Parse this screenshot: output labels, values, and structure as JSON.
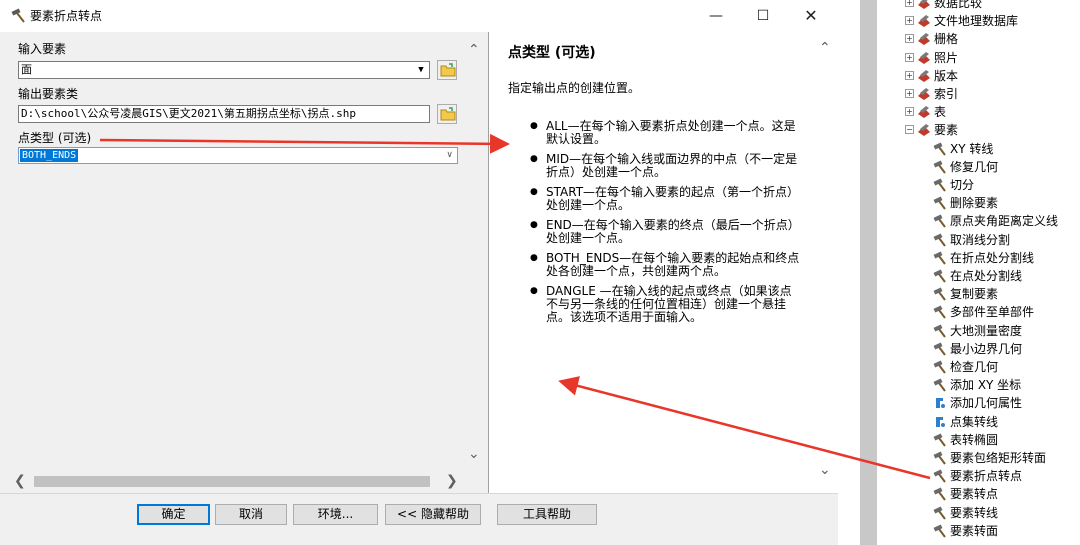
{
  "window": {
    "title": "要素折点转点",
    "minimize_glyph": "—",
    "maximize_glyph": "☐",
    "close_glyph": "✕"
  },
  "form": {
    "input_label": "输入要素",
    "input_value": "面",
    "output_label": "输出要素类",
    "output_value": "D:\\school\\公众号凌晨GIS\\更文2021\\第五期拐点坐标\\拐点.shp",
    "point_type_label": "点类型 (可选)",
    "point_type_value": "BOTH_ENDS"
  },
  "help": {
    "title": "点类型 (可选)",
    "description": "指定输出点的创建位置。",
    "items": [
      "ALL—在每个输入要素折点处创建一个点。这是默认设置。",
      "MID—在每个输入线或面边界的中点（不一定是折点）处创建一个点。",
      "START—在每个输入要素的起点（第一个折点）处创建一个点。",
      "END—在每个输入要素的终点（最后一个折点）处创建一个点。",
      "BOTH_ENDS—在每个输入要素的起始点和终点处各创建一个点，共创建两个点。",
      "DANGLE —在输入线的起点或终点（如果该点不与另一条线的任何位置相连）创建一个悬挂点。该选项不适用于面输入。"
    ]
  },
  "buttons": {
    "ok": "确定",
    "cancel": "取消",
    "env": "环境...",
    "hide_help": "<< 隐藏帮助",
    "tool_help": "工具帮助"
  },
  "tree": {
    "groups": [
      {
        "label": "数据比较",
        "expander": "+"
      },
      {
        "label": "文件地理数据库",
        "expander": "+"
      },
      {
        "label": "栅格",
        "expander": "+"
      },
      {
        "label": "照片",
        "expander": "+"
      },
      {
        "label": "版本",
        "expander": "+"
      },
      {
        "label": "索引",
        "expander": "+"
      },
      {
        "label": "表",
        "expander": "+"
      },
      {
        "label": "要素",
        "expander": "−"
      }
    ],
    "tools": [
      {
        "label": "XY 转线",
        "icon": "hammer-icon"
      },
      {
        "label": "修复几何",
        "icon": "hammer-icon"
      },
      {
        "label": "切分",
        "icon": "hammer-icon"
      },
      {
        "label": "删除要素",
        "icon": "hammer-icon"
      },
      {
        "label": "原点夹角距离定义线",
        "icon": "hammer-icon"
      },
      {
        "label": "取消线分割",
        "icon": "hammer-icon"
      },
      {
        "label": "在折点处分割线",
        "icon": "hammer-icon"
      },
      {
        "label": "在点处分割线",
        "icon": "hammer-icon"
      },
      {
        "label": "复制要素",
        "icon": "hammer-icon"
      },
      {
        "label": "多部件至单部件",
        "icon": "hammer-icon"
      },
      {
        "label": "大地测量密度",
        "icon": "hammer-icon"
      },
      {
        "label": "最小边界几何",
        "icon": "hammer-icon"
      },
      {
        "label": "检查几何",
        "icon": "hammer-icon"
      },
      {
        "label": "添加 XY 坐标",
        "icon": "hammer-icon"
      },
      {
        "label": "添加几何属性",
        "icon": "script-icon"
      },
      {
        "label": "点集转线",
        "icon": "script-icon"
      },
      {
        "label": "表转椭圆",
        "icon": "hammer-icon"
      },
      {
        "label": "要素包络矩形转面",
        "icon": "hammer-icon"
      },
      {
        "label": "要素折点转点",
        "icon": "hammer-icon"
      },
      {
        "label": "要素转点",
        "icon": "hammer-icon"
      },
      {
        "label": "要素转线",
        "icon": "hammer-icon"
      },
      {
        "label": "要素转面",
        "icon": "hammer-icon"
      }
    ]
  },
  "colors": {
    "selection": "#0078d7",
    "annotation_arrow": "#e8372a"
  }
}
